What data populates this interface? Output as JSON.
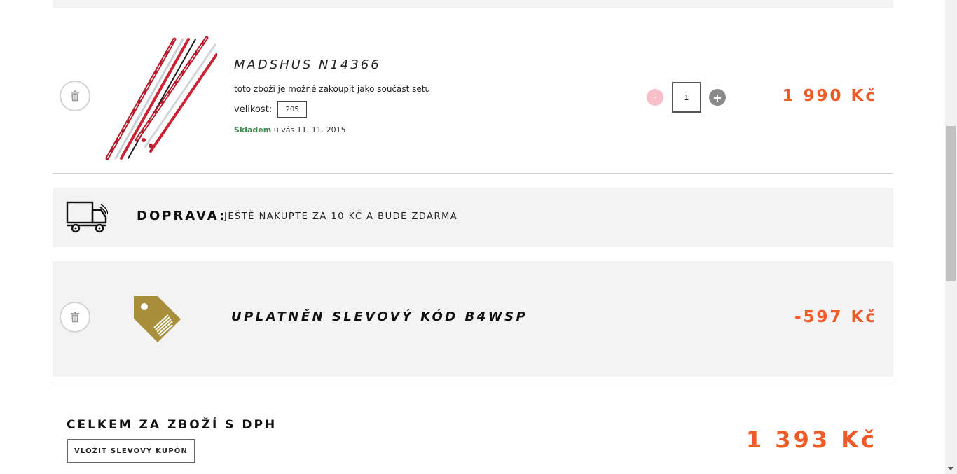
{
  "product": {
    "name": "MADSHUS N14366",
    "note": "toto zboži je možné zakoupit jako součást setu",
    "size_label": "velikost:",
    "size_value": "205",
    "stock_status": "Skladem",
    "stock_delivery": " u vás 11. 11. 2015",
    "quantity": "1",
    "qty_minus": "-",
    "qty_plus": "+",
    "price": "1 990 Kč"
  },
  "shipping": {
    "label": "DOPRAVA:",
    "text": "JEŠTĚ NAKUPTE ZA 10 KČ A BUDE ZDARMA"
  },
  "discount": {
    "label": "UPLATNĚN SLEVOVÝ KÓD B4WSP",
    "amount": "-597 Kč"
  },
  "total": {
    "label": "CELKEM ZA ZBOŽÍ S DPH",
    "amount": "1 393 Kč",
    "coupon_button": "VLOŽIT SLEVOVÝ KUPÓN"
  },
  "colors": {
    "price": "#f05a28",
    "stock": "#3a8a4f",
    "tag": "#a88f3c",
    "box_bg": "#f3f3f3"
  },
  "icons": [
    "trash-icon",
    "truck-icon",
    "tag-icon"
  ]
}
